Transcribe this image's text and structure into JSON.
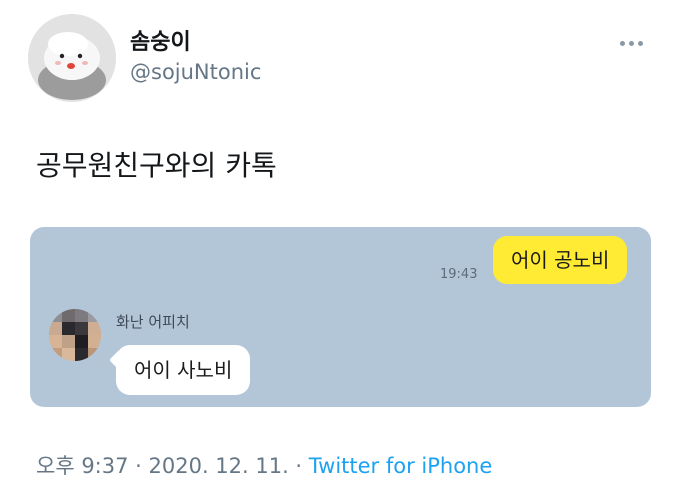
{
  "profile": {
    "display_name": "솜숭이",
    "handle": "@sojuNtonic",
    "avatar_icon": "plush-toy-avatar-icon"
  },
  "more_icon": "more-dots-icon",
  "tweet": {
    "text": "공무원친구와의 카톡"
  },
  "chat": {
    "background_color": "#b3c6d8",
    "sent_bubble_color": "#ffeb33",
    "sent_message": "어이 공노비",
    "sent_time": "19:43",
    "friend_name": "화난 어피치",
    "received_message": "어이 사노비"
  },
  "footer": {
    "time_date": "오후 9:37 · 2020. 12. 11. · ",
    "source": "Twitter for iPhone",
    "source_color": "#1da1f2"
  }
}
